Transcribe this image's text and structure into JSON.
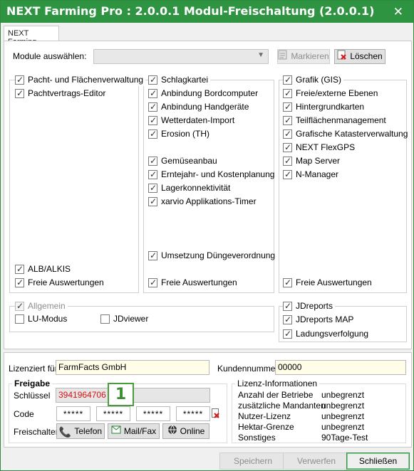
{
  "window": {
    "title": "NEXT Farming Pro : 2.0.0.1  Modul-Freischaltung (2.0.0.1)",
    "close_icon": "close-icon"
  },
  "tab": {
    "label": "NEXT Farming"
  },
  "module_select": {
    "label": "Module auswählen:",
    "value": "",
    "mark_button": "Markieren",
    "delete_button": "Löschen"
  },
  "col1": {
    "items": [
      {
        "label": "Pacht- und Flächenverwaltung",
        "checked": true
      },
      {
        "label": "Pachtvertrags-Editor",
        "checked": true
      }
    ],
    "bottom": [
      {
        "label": "ALB/ALKIS",
        "checked": true
      },
      {
        "label": "Freie Auswertungen",
        "checked": true
      }
    ]
  },
  "col2": {
    "items": [
      {
        "label": "Schlagkartei",
        "checked": true
      },
      {
        "label": "Anbindung Bordcomputer",
        "checked": true
      },
      {
        "label": "Anbindung Handgeräte",
        "checked": true
      },
      {
        "label": "Wetterdaten-Import",
        "checked": true
      },
      {
        "label": "Erosion (TH)",
        "checked": true
      },
      {
        "label": "Gemüseanbau",
        "checked": true
      },
      {
        "label": "Erntejahr- und Kostenplanung",
        "checked": true
      },
      {
        "label": "Lagerkonnektivität",
        "checked": true
      },
      {
        "label": "xarvio Applikations-Timer",
        "checked": true
      },
      {
        "label": "Umsetzung Düngeverordnung",
        "checked": true
      },
      {
        "label": "Freie Auswertungen",
        "checked": true
      }
    ]
  },
  "col3": {
    "items": [
      {
        "label": "Grafik (GIS)",
        "checked": true
      },
      {
        "label": "Freie/externe Ebenen",
        "checked": true
      },
      {
        "label": "Hintergrundkarten",
        "checked": true
      },
      {
        "label": "Teilflächenmanagement",
        "checked": true
      },
      {
        "label": "Grafische Katasterverwaltung",
        "checked": true
      },
      {
        "label": "NEXT FlexGPS",
        "checked": true
      },
      {
        "label": "Map Server",
        "checked": true
      },
      {
        "label": "N-Manager",
        "checked": true
      },
      {
        "label": "Freie Auswertungen",
        "checked": true
      }
    ]
  },
  "allgemein": {
    "title": "Allgemein",
    "items": [
      {
        "label": "LU-Modus",
        "checked": false
      },
      {
        "label": "JDviewer",
        "checked": false
      }
    ]
  },
  "jd": {
    "items": [
      {
        "label": "JDreports",
        "checked": true
      },
      {
        "label": "JDreports MAP",
        "checked": true
      },
      {
        "label": "Ladungsverfolgung",
        "checked": true
      }
    ]
  },
  "license": {
    "licensed_for_label": "Lizenziert für",
    "licensed_for_value": "FarmFacts GmbH",
    "customer_no_label": "Kundennummer",
    "customer_no_value": "00000",
    "release_title": "Freigabe",
    "key_label": "Schlüssel",
    "key_value": "3941964706",
    "code_label": "Code",
    "codes": [
      "*****",
      "*****",
      "*****",
      "*****"
    ],
    "unlock_label": "Freischalten",
    "phone_button": "Telefon",
    "mail_button": "Mail/Fax",
    "online_button": "Online",
    "callout": "1",
    "info_title": "Lizenz-Informationen",
    "info": [
      {
        "k": "Anzahl der Betriebe",
        "v": "unbegrenzt"
      },
      {
        "k": "zusätzliche Mandanten",
        "v": "unbegrenzt"
      },
      {
        "k": "Nutzer-Lizenz",
        "v": "unbegrenzt"
      },
      {
        "k": "Hektar-Grenze",
        "v": "unbegrenzt"
      },
      {
        "k": "Sonstiges",
        "v": "90Tage-Test"
      }
    ]
  },
  "footer": {
    "save": "Speichern",
    "discard": "Verwerfen",
    "close": "Schließen"
  },
  "colors": {
    "titlebar": "#2e9441",
    "accent": "#4a9d3c",
    "key_text": "#dd1111"
  }
}
